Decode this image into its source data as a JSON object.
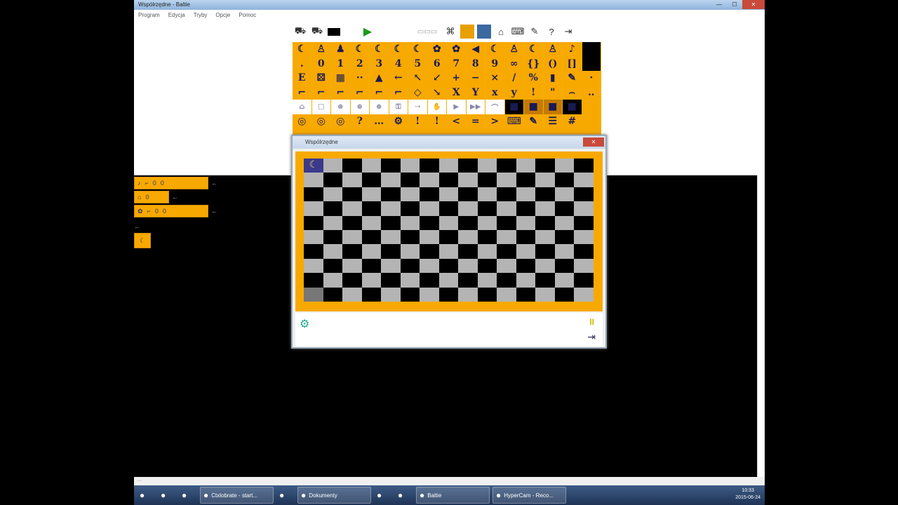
{
  "window": {
    "title": "Wspólrzędne - Baltie",
    "min": "—",
    "max": "☐",
    "close": "✕"
  },
  "menu": [
    "Program",
    "Edycja",
    "Tryby",
    "Opcje",
    "Pomoc"
  ],
  "palette_rows": [
    [
      "☾",
      "♙",
      "♟",
      "☾",
      "☾",
      "☾",
      "☾",
      "✿",
      "✿",
      "◀",
      "☾",
      "♙",
      "☾",
      "♙",
      "♪",
      ""
    ],
    [
      ".",
      "0",
      "1",
      "2",
      "3",
      "4",
      "5",
      "6",
      "7",
      "8",
      "9",
      "∞",
      "{}",
      "()",
      "[]",
      ""
    ],
    [
      "E",
      "⚄",
      "▦",
      "··",
      "▲",
      "←",
      "↖",
      "↙",
      "+",
      "−",
      "×",
      "/",
      "%",
      "▮",
      "✎",
      "·"
    ],
    [
      "⌐",
      "⌐",
      "⌐",
      "⌐",
      "⌐",
      "⌐",
      "◇",
      "↘",
      "X",
      "Y",
      "x",
      "y",
      "!",
      "\"",
      "⌢",
      "‥"
    ],
    [
      "⌂",
      "□",
      "⊛",
      "⊛",
      "⊕",
      "⚿",
      "⇢",
      "✋",
      "▶",
      "▶▶",
      "⌒",
      "■",
      "■",
      "■",
      "■",
      ""
    ],
    [
      "◎",
      "◎",
      "◎",
      "?",
      "…",
      "⚙",
      "!",
      "!",
      "<",
      "=",
      ">",
      "⌨",
      "✎",
      "☰",
      "#",
      ""
    ]
  ],
  "program": {
    "line1": [
      "♪",
      "⌐",
      "0",
      "0"
    ],
    "line2": [
      "⌂",
      "0"
    ],
    "line3": [
      "✿",
      "⌐",
      "0",
      "0"
    ],
    "line4_icon": "wizard-tile"
  },
  "subwindow": {
    "title": "Wspólrzędne",
    "close": "✕",
    "pause": "II"
  },
  "taskbar": {
    "items": [
      {
        "label": "",
        "icon": "windows-start-icon"
      },
      {
        "label": "",
        "icon": "ie-icon"
      },
      {
        "label": "",
        "icon": "firefox-icon"
      },
      {
        "label": "Ctxlobrate - start...",
        "icon": "chrome-icon"
      },
      {
        "label": "",
        "icon": "opera-icon"
      },
      {
        "label": "Dokumenty",
        "icon": "folder-icon"
      },
      {
        "label": "",
        "icon": "excel-icon"
      },
      {
        "label": "",
        "icon": "v-icon"
      },
      {
        "label": "Baltie",
        "icon": "baltie-icon"
      },
      {
        "label": "HyperCam - Reco...",
        "icon": "hypercam-icon"
      }
    ],
    "time": "10:33",
    "date": "2015-06-24"
  },
  "colors": {
    "accent_orange": "#f8a900",
    "board_dark": "#000000",
    "board_light": "#b4b4b4"
  }
}
